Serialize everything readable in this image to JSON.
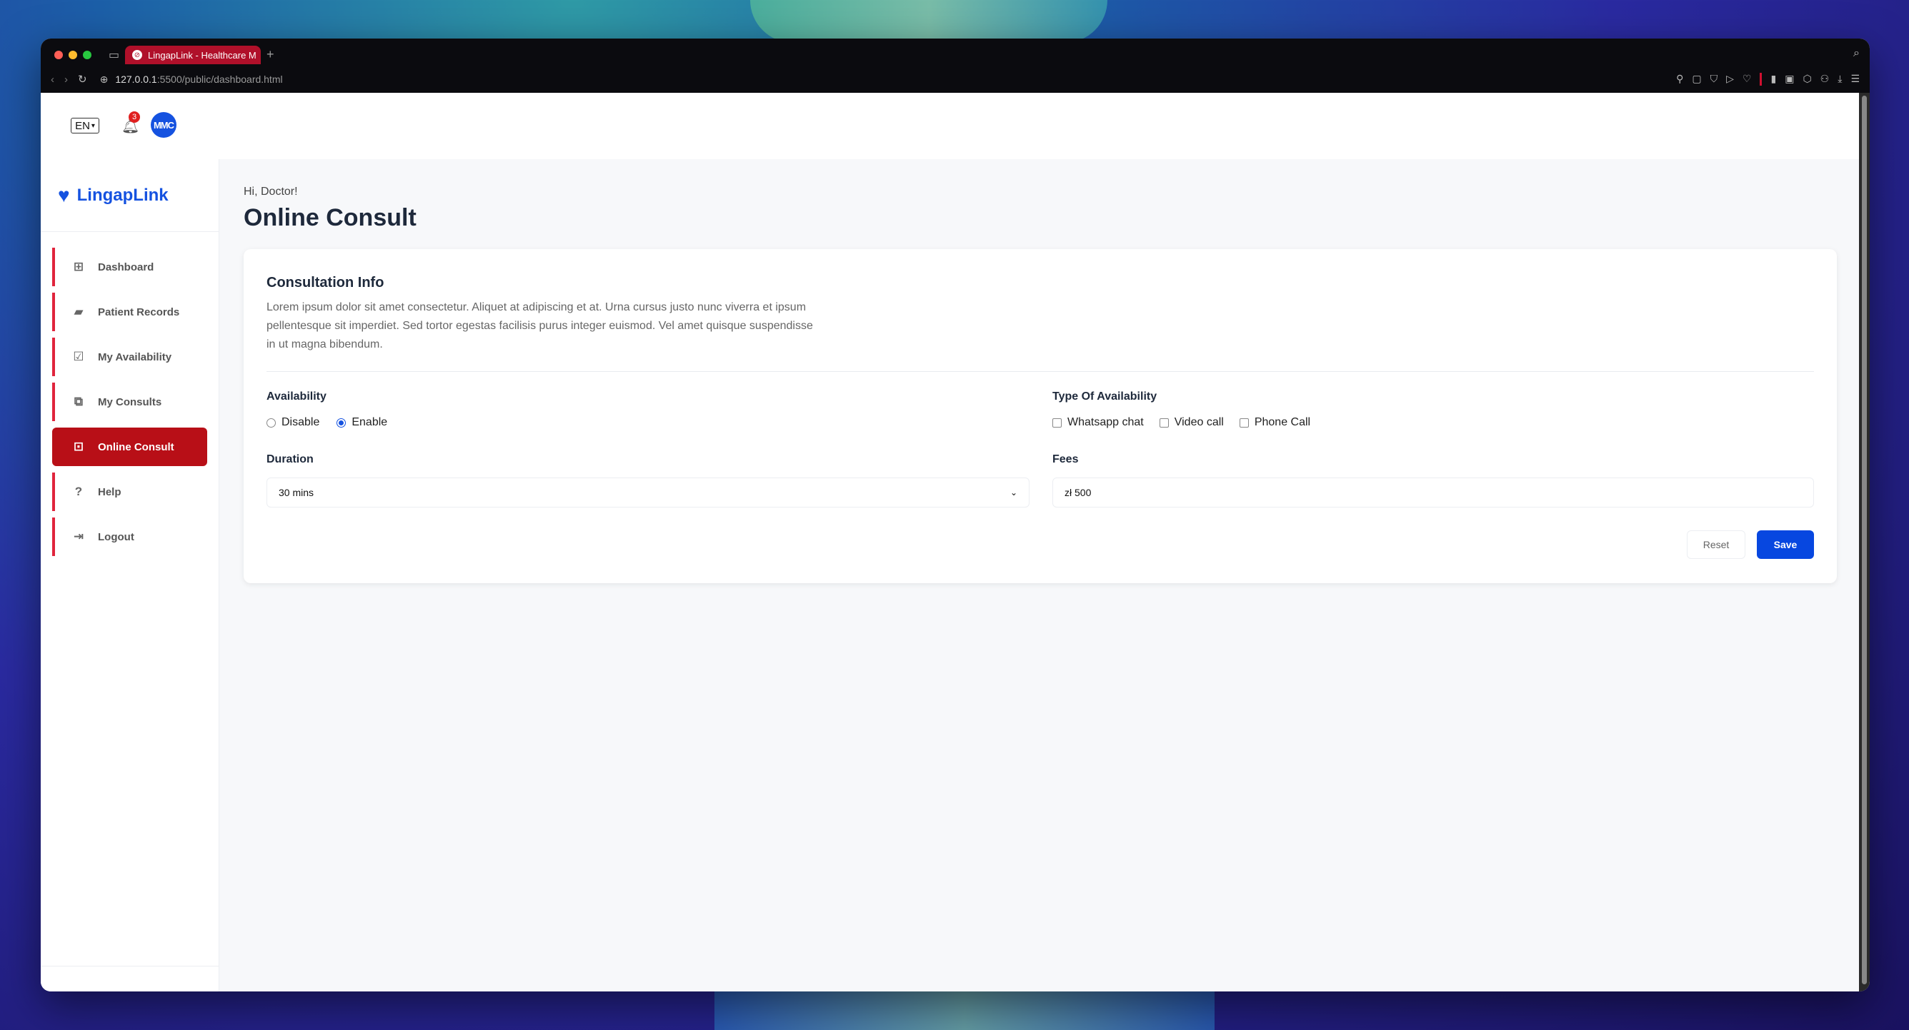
{
  "browser": {
    "tab_title": "LingapLink - Healthcare M",
    "url_host": "127.0.0.1",
    "url_path": ":5500/public/dashboard.html",
    "new_tab_symbol": "+"
  },
  "topbar": {
    "language": "EN",
    "notification_count": "3",
    "avatar_initials": "MMC"
  },
  "brand": {
    "name": "LingapLink"
  },
  "sidebar": {
    "items": [
      {
        "label": "Dashboard",
        "icon": "grid-icon"
      },
      {
        "label": "Patient Records",
        "icon": "folder-icon"
      },
      {
        "label": "My Availability",
        "icon": "calendar-check-icon"
      },
      {
        "label": "My Consults",
        "icon": "consult-icon"
      },
      {
        "label": "Online Consult",
        "icon": "monitor-icon",
        "active": true
      },
      {
        "label": "Help",
        "icon": "help-icon"
      },
      {
        "label": "Logout",
        "icon": "logout-icon"
      }
    ]
  },
  "main": {
    "greeting": "Hi, Doctor!",
    "title": "Online Consult"
  },
  "card": {
    "title": "Consultation Info",
    "description": "Lorem ipsum dolor sit amet consectetur. Aliquet at adipiscing et at. Urna cursus justo nunc viverra et ipsum pellentesque sit imperdiet. Sed tortor egestas facilisis purus integer euismod. Vel amet quisque suspendisse in ut magna bibendum.",
    "availability": {
      "label": "Availability",
      "options": [
        "Disable",
        "Enable"
      ],
      "selected": "Enable"
    },
    "type": {
      "label": "Type Of Availability",
      "options": [
        "Whatsapp chat",
        "Video call",
        "Phone Call"
      ]
    },
    "duration": {
      "label": "Duration",
      "value": "30 mins"
    },
    "fees": {
      "label": "Fees",
      "value": "zł 500"
    },
    "reset_label": "Reset",
    "save_label": "Save"
  },
  "colors": {
    "brand_blue": "#1552e0",
    "active_red": "#b80f17",
    "save_blue": "#0747e0"
  }
}
